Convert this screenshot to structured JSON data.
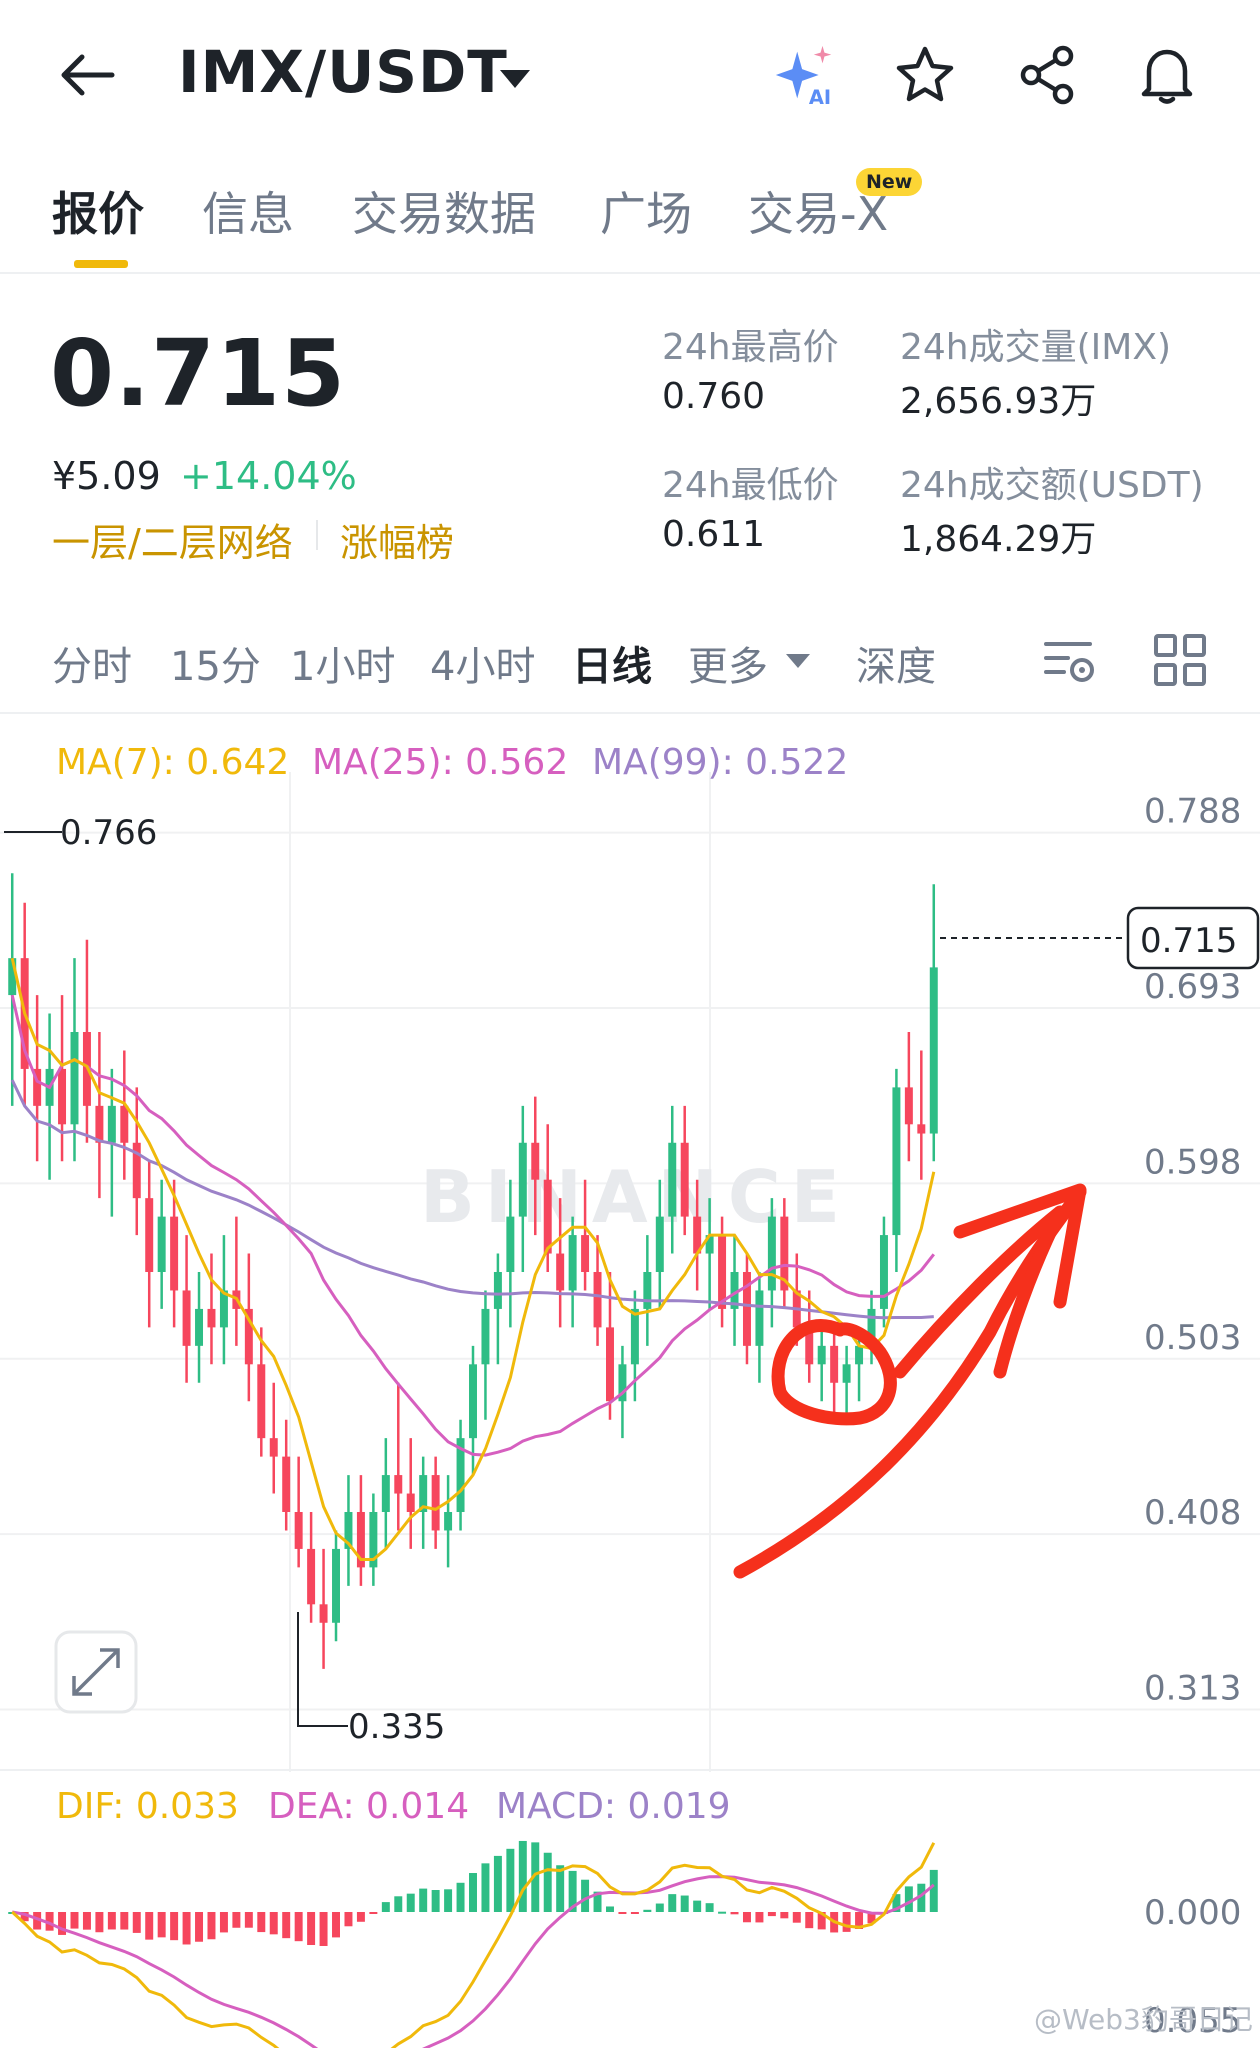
{
  "header": {
    "title": "IMX/USDT",
    "icons": [
      "back-arrow-icon",
      "ai-sparkle-icon",
      "star-icon",
      "share-icon",
      "bell-icon"
    ],
    "ai_label": "AI"
  },
  "tabs": {
    "items": [
      "报价",
      "信息",
      "交易数据",
      "广场",
      "交易-X"
    ],
    "active": "报价",
    "new_badge": "New"
  },
  "ticker": {
    "price": "0.715",
    "cny": "¥5.09",
    "change": "+14.04%",
    "tag_network": "一层/二层网络",
    "tag_rank": "涨幅榜",
    "stats": [
      {
        "label": "24h最高价",
        "value": "0.760"
      },
      {
        "label": "24h成交量(IMX)",
        "value": "2,656.93万"
      },
      {
        "label": "24h最低价",
        "value": "0.611"
      },
      {
        "label": "24h成交额(USDT)",
        "value": "1,864.29万"
      }
    ]
  },
  "intervals": {
    "items": [
      "分时",
      "15分",
      "1小时",
      "4小时",
      "日线",
      "更多",
      "深度"
    ],
    "active": "日线"
  },
  "chart_data": {
    "type": "candlestick",
    "indicators": {
      "ma7": "MA(7): 0.642",
      "ma25": "MA(25): 0.562",
      "ma99": "MA(99): 0.522"
    },
    "y_ticks": [
      "0.788",
      "0.693",
      "0.598",
      "0.503",
      "0.408",
      "0.313"
    ],
    "ylim": [
      0.29,
      0.81
    ],
    "last_price_label": "0.715",
    "high_label": "0.766",
    "low_label": "0.335",
    "watermark": "BINANCE",
    "colors": {
      "up": "#2ebd85",
      "down": "#f6465d",
      "ma7": "#f0b90b",
      "ma25": "#d65fbf",
      "ma99": "#9c82c8",
      "annotation": "#f5301c"
    },
    "candles": [
      {
        "o": 0.7,
        "h": 0.766,
        "l": 0.64,
        "c": 0.72
      },
      {
        "o": 0.72,
        "h": 0.75,
        "l": 0.64,
        "c": 0.66
      },
      {
        "o": 0.66,
        "h": 0.7,
        "l": 0.61,
        "c": 0.64
      },
      {
        "o": 0.64,
        "h": 0.69,
        "l": 0.6,
        "c": 0.66
      },
      {
        "o": 0.66,
        "h": 0.7,
        "l": 0.61,
        "c": 0.63
      },
      {
        "o": 0.63,
        "h": 0.72,
        "l": 0.61,
        "c": 0.68
      },
      {
        "o": 0.68,
        "h": 0.73,
        "l": 0.62,
        "c": 0.64
      },
      {
        "o": 0.64,
        "h": 0.68,
        "l": 0.59,
        "c": 0.62
      },
      {
        "o": 0.62,
        "h": 0.66,
        "l": 0.58,
        "c": 0.64
      },
      {
        "o": 0.64,
        "h": 0.67,
        "l": 0.6,
        "c": 0.62
      },
      {
        "o": 0.62,
        "h": 0.65,
        "l": 0.57,
        "c": 0.59
      },
      {
        "o": 0.59,
        "h": 0.61,
        "l": 0.52,
        "c": 0.55
      },
      {
        "o": 0.55,
        "h": 0.6,
        "l": 0.53,
        "c": 0.58
      },
      {
        "o": 0.58,
        "h": 0.6,
        "l": 0.52,
        "c": 0.54
      },
      {
        "o": 0.54,
        "h": 0.57,
        "l": 0.49,
        "c": 0.51
      },
      {
        "o": 0.51,
        "h": 0.55,
        "l": 0.49,
        "c": 0.53
      },
      {
        "o": 0.53,
        "h": 0.56,
        "l": 0.5,
        "c": 0.52
      },
      {
        "o": 0.52,
        "h": 0.57,
        "l": 0.5,
        "c": 0.54
      },
      {
        "o": 0.54,
        "h": 0.58,
        "l": 0.51,
        "c": 0.53
      },
      {
        "o": 0.53,
        "h": 0.56,
        "l": 0.48,
        "c": 0.5
      },
      {
        "o": 0.5,
        "h": 0.52,
        "l": 0.45,
        "c": 0.46
      },
      {
        "o": 0.46,
        "h": 0.49,
        "l": 0.43,
        "c": 0.45
      },
      {
        "o": 0.45,
        "h": 0.47,
        "l": 0.41,
        "c": 0.42
      },
      {
        "o": 0.42,
        "h": 0.45,
        "l": 0.39,
        "c": 0.4
      },
      {
        "o": 0.4,
        "h": 0.42,
        "l": 0.36,
        "c": 0.37
      },
      {
        "o": 0.37,
        "h": 0.4,
        "l": 0.335,
        "c": 0.36
      },
      {
        "o": 0.36,
        "h": 0.41,
        "l": 0.35,
        "c": 0.4
      },
      {
        "o": 0.4,
        "h": 0.44,
        "l": 0.38,
        "c": 0.42
      },
      {
        "o": 0.42,
        "h": 0.44,
        "l": 0.38,
        "c": 0.39
      },
      {
        "o": 0.39,
        "h": 0.43,
        "l": 0.38,
        "c": 0.42
      },
      {
        "o": 0.42,
        "h": 0.46,
        "l": 0.4,
        "c": 0.44
      },
      {
        "o": 0.44,
        "h": 0.49,
        "l": 0.41,
        "c": 0.43
      },
      {
        "o": 0.43,
        "h": 0.46,
        "l": 0.4,
        "c": 0.42
      },
      {
        "o": 0.42,
        "h": 0.45,
        "l": 0.4,
        "c": 0.44
      },
      {
        "o": 0.44,
        "h": 0.45,
        "l": 0.4,
        "c": 0.41
      },
      {
        "o": 0.41,
        "h": 0.44,
        "l": 0.39,
        "c": 0.42
      },
      {
        "o": 0.42,
        "h": 0.47,
        "l": 0.41,
        "c": 0.46
      },
      {
        "o": 0.46,
        "h": 0.51,
        "l": 0.44,
        "c": 0.5
      },
      {
        "o": 0.5,
        "h": 0.54,
        "l": 0.47,
        "c": 0.53
      },
      {
        "o": 0.53,
        "h": 0.56,
        "l": 0.5,
        "c": 0.55
      },
      {
        "o": 0.55,
        "h": 0.6,
        "l": 0.52,
        "c": 0.58
      },
      {
        "o": 0.58,
        "h": 0.64,
        "l": 0.55,
        "c": 0.62
      },
      {
        "o": 0.62,
        "h": 0.645,
        "l": 0.57,
        "c": 0.6
      },
      {
        "o": 0.6,
        "h": 0.63,
        "l": 0.55,
        "c": 0.56
      },
      {
        "o": 0.56,
        "h": 0.59,
        "l": 0.52,
        "c": 0.54
      },
      {
        "o": 0.54,
        "h": 0.58,
        "l": 0.52,
        "c": 0.57
      },
      {
        "o": 0.57,
        "h": 0.6,
        "l": 0.54,
        "c": 0.55
      },
      {
        "o": 0.55,
        "h": 0.57,
        "l": 0.51,
        "c": 0.52
      },
      {
        "o": 0.52,
        "h": 0.55,
        "l": 0.47,
        "c": 0.48
      },
      {
        "o": 0.48,
        "h": 0.51,
        "l": 0.46,
        "c": 0.5
      },
      {
        "o": 0.5,
        "h": 0.54,
        "l": 0.48,
        "c": 0.53
      },
      {
        "o": 0.53,
        "h": 0.57,
        "l": 0.51,
        "c": 0.55
      },
      {
        "o": 0.55,
        "h": 0.6,
        "l": 0.53,
        "c": 0.58
      },
      {
        "o": 0.58,
        "h": 0.64,
        "l": 0.56,
        "c": 0.62
      },
      {
        "o": 0.62,
        "h": 0.64,
        "l": 0.57,
        "c": 0.58
      },
      {
        "o": 0.58,
        "h": 0.6,
        "l": 0.54,
        "c": 0.56
      },
      {
        "o": 0.56,
        "h": 0.59,
        "l": 0.53,
        "c": 0.57
      },
      {
        "o": 0.57,
        "h": 0.58,
        "l": 0.52,
        "c": 0.53
      },
      {
        "o": 0.53,
        "h": 0.57,
        "l": 0.51,
        "c": 0.55
      },
      {
        "o": 0.55,
        "h": 0.56,
        "l": 0.5,
        "c": 0.51
      },
      {
        "o": 0.51,
        "h": 0.55,
        "l": 0.49,
        "c": 0.54
      },
      {
        "o": 0.54,
        "h": 0.59,
        "l": 0.52,
        "c": 0.58
      },
      {
        "o": 0.58,
        "h": 0.59,
        "l": 0.53,
        "c": 0.54
      },
      {
        "o": 0.54,
        "h": 0.56,
        "l": 0.51,
        "c": 0.52
      },
      {
        "o": 0.52,
        "h": 0.54,
        "l": 0.49,
        "c": 0.5
      },
      {
        "o": 0.5,
        "h": 0.52,
        "l": 0.48,
        "c": 0.51
      },
      {
        "o": 0.51,
        "h": 0.52,
        "l": 0.47,
        "c": 0.49
      },
      {
        "o": 0.49,
        "h": 0.51,
        "l": 0.47,
        "c": 0.5
      },
      {
        "o": 0.5,
        "h": 0.52,
        "l": 0.48,
        "c": 0.51
      },
      {
        "o": 0.51,
        "h": 0.54,
        "l": 0.5,
        "c": 0.53
      },
      {
        "o": 0.53,
        "h": 0.58,
        "l": 0.52,
        "c": 0.57
      },
      {
        "o": 0.57,
        "h": 0.66,
        "l": 0.55,
        "c": 0.65
      },
      {
        "o": 0.65,
        "h": 0.68,
        "l": 0.61,
        "c": 0.63
      },
      {
        "o": 0.63,
        "h": 0.67,
        "l": 0.6,
        "c": 0.625
      },
      {
        "o": 0.625,
        "h": 0.76,
        "l": 0.61,
        "c": 0.715
      }
    ]
  },
  "macd": {
    "dif": "DIF: 0.033",
    "dea": "DEA: 0.014",
    "macd": "MACD: 0.019",
    "zero_tick": "0.000",
    "bottom_tick": "0.055"
  },
  "footer": {
    "credit": "@Web3豹哥日记"
  }
}
